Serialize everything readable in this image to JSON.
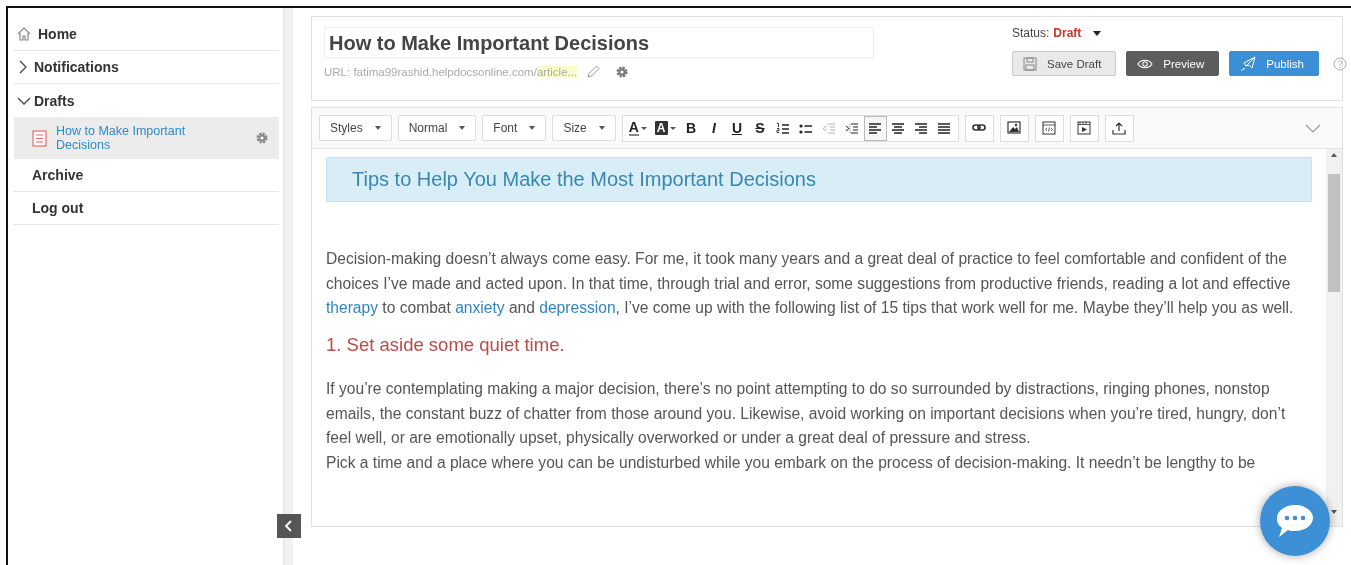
{
  "sidebar": {
    "items": [
      {
        "kind": "home",
        "label": "Home"
      },
      {
        "kind": "folder",
        "label": "Notifications",
        "expanded": false
      },
      {
        "kind": "folder",
        "label": "Drafts",
        "expanded": true,
        "children": [
          {
            "label": "How to Make Important Decisions",
            "selected": true
          }
        ]
      },
      {
        "kind": "plain",
        "label": "Archive"
      },
      {
        "kind": "plain",
        "label": "Log out"
      }
    ]
  },
  "header": {
    "title": "How to Make Important Decisions",
    "url_label": "URL:",
    "url_base": "fatima99rashid.helpdocsonline.com/",
    "url_highlight": "article...",
    "status_label": "Status:",
    "status_value": "Draft",
    "buttons": [
      {
        "kind": "save",
        "label": "Save Draft"
      },
      {
        "kind": "preview",
        "label": "Preview"
      },
      {
        "kind": "publish",
        "label": "Publish"
      }
    ]
  },
  "toolbar": {
    "dropdowns": [
      {
        "label": "Styles"
      },
      {
        "label": "Normal"
      },
      {
        "label": "Font"
      },
      {
        "label": "Size"
      }
    ],
    "formatting": [
      {
        "kind": "text-color",
        "label": "A",
        "selected": false,
        "disabled": false
      },
      {
        "kind": "highlight",
        "label": "A",
        "selected": false,
        "disabled": false
      },
      {
        "kind": "bold",
        "label": "B",
        "selected": false,
        "disabled": false
      },
      {
        "kind": "italic",
        "label": "I",
        "selected": false,
        "disabled": false
      },
      {
        "kind": "underline",
        "label": "U",
        "selected": false,
        "disabled": false
      },
      {
        "kind": "strike",
        "label": "S",
        "selected": false,
        "disabled": false
      },
      {
        "kind": "ordered-list",
        "selected": false,
        "disabled": false
      },
      {
        "kind": "bullet-list",
        "selected": false,
        "disabled": false
      },
      {
        "kind": "outdent",
        "selected": false,
        "disabled": true
      },
      {
        "kind": "indent",
        "selected": false,
        "disabled": false
      },
      {
        "kind": "align-left",
        "selected": true,
        "disabled": false
      },
      {
        "kind": "align-center",
        "selected": false,
        "disabled": false
      },
      {
        "kind": "align-right",
        "selected": false,
        "disabled": false
      },
      {
        "kind": "justify",
        "selected": false,
        "disabled": false
      }
    ],
    "insert": [
      {
        "kind": "link"
      },
      {
        "kind": "image"
      },
      {
        "kind": "embed"
      },
      {
        "kind": "video"
      },
      {
        "kind": "upload"
      }
    ]
  },
  "content": {
    "heading": "Tips to Help You Make the Most Important Decisions",
    "blocks": [
      {
        "kind": "paragraph",
        "segments": [
          {
            "kind": "text",
            "text": "Decision-making doesn’t always come easy. For me, it took many years and a great deal of practice to feel comfortable and confident of the choices I’ve made and acted upon. In that time, through trial and error, some suggestions from productive friends, reading a lot and effective "
          },
          {
            "kind": "link",
            "text": "therapy"
          },
          {
            "kind": "text",
            "text": " to combat "
          },
          {
            "kind": "link",
            "text": "anxiety"
          },
          {
            "kind": "text",
            "text": " and "
          },
          {
            "kind": "link",
            "text": "depression"
          },
          {
            "kind": "text",
            "text": ", I’ve come up with the following list of 15 tips that work well for me. Maybe they’ll help you as well."
          }
        ]
      },
      {
        "kind": "heading",
        "text": "1. Set aside some quiet time."
      },
      {
        "kind": "paragraph",
        "segments": [
          {
            "kind": "text",
            "text": "If you’re contemplating making a major decision, there’s no point attempting to do so surrounded by distractions, ringing phones, nonstop emails, the constant buzz of chatter from those around you. Likewise, avoid working on important decisions when you’re tired, hungry, don’t feel well, or are emotionally upset, physically overworked or under a great deal of pressure and stress."
          }
        ]
      },
      {
        "kind": "continuation",
        "segments": [
          {
            "kind": "text",
            "text": "Pick a time and a place where you can be undisturbed while you embark on the process of decision-making. It needn’t be lengthy to be"
          }
        ]
      }
    ]
  }
}
